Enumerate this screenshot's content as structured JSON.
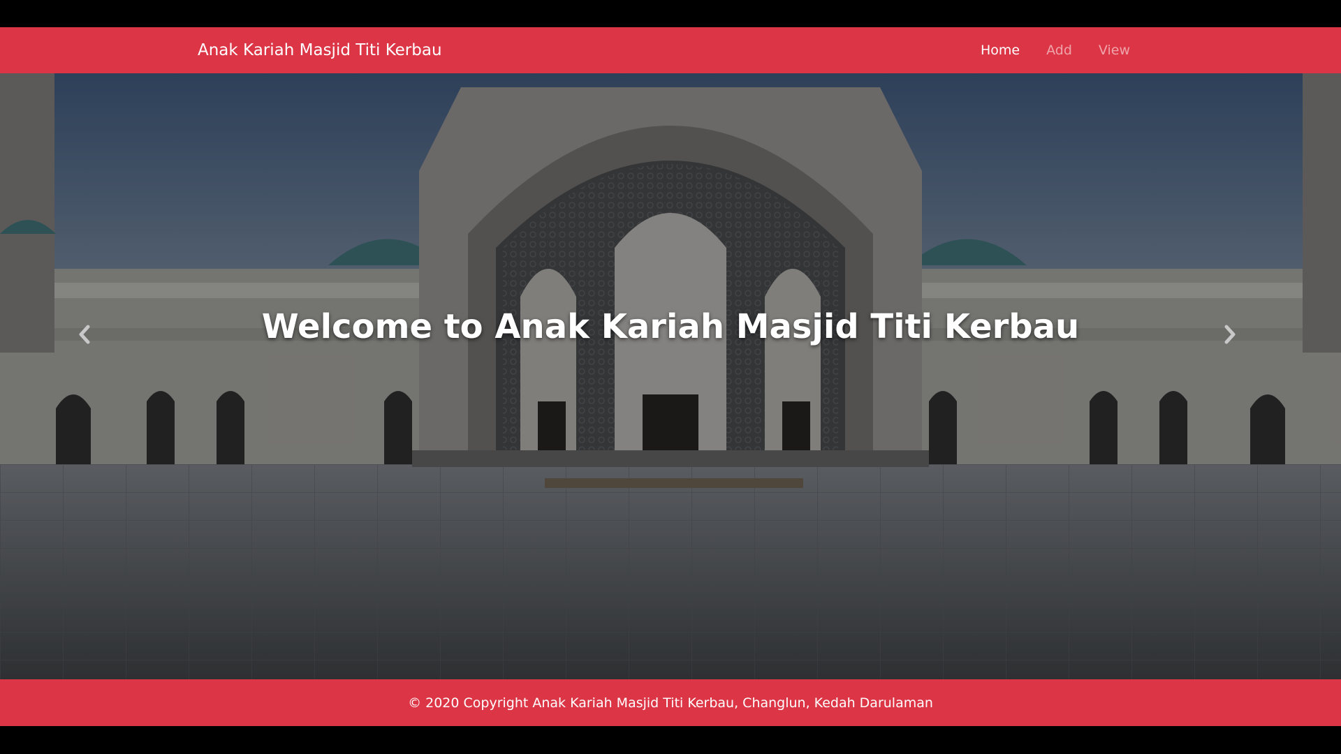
{
  "navbar": {
    "brand": "Anak Kariah Masjid Titi Kerbau",
    "links": [
      {
        "label": "Home",
        "active": true
      },
      {
        "label": "Add",
        "active": false
      },
      {
        "label": "View",
        "active": false
      }
    ]
  },
  "hero": {
    "caption": "Welcome to Anak Kariah Masjid Titi Kerbau",
    "prev_icon": "chevron-left-icon",
    "next_icon": "chevron-right-icon"
  },
  "footer": {
    "text": "© 2020 Copyright Anak Kariah Masjid Titi Kerbau, Changlun, Kedah Darulaman"
  },
  "colors": {
    "primary": "#dc3545",
    "nav_active": "#ffffff",
    "nav_muted": "rgba(255,255,255,0.55)"
  }
}
